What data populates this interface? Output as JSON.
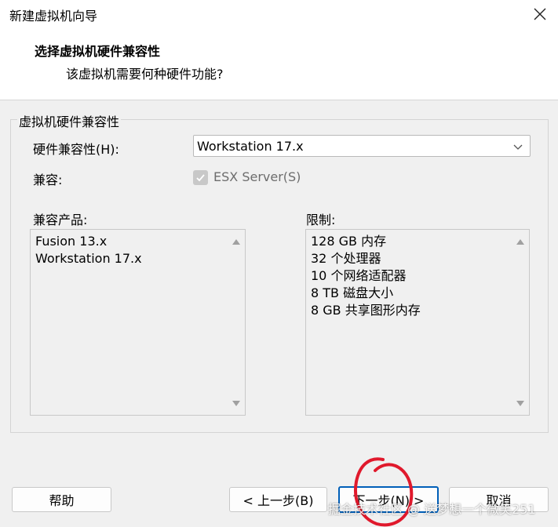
{
  "window": {
    "title": "新建虚拟机向导"
  },
  "header": {
    "title": "选择虚拟机硬件兼容性",
    "subtitle": "该虚拟机需要何种硬件功能?"
  },
  "group": {
    "legend": "虚拟机硬件兼容性",
    "hw_compat_label": "硬件兼容性(H):",
    "hw_compat_value": "Workstation 17.x",
    "compatible_label": "兼容:",
    "esx_label": "ESX Server(S)",
    "esx_checked": true,
    "products_label": "兼容产品:",
    "products": [
      "Fusion 13.x",
      "Workstation 17.x"
    ],
    "limits_label": "限制:",
    "limits": [
      "128 GB 内存",
      "32 个处理器",
      "10 个网络适配器",
      "8 TB 磁盘大小",
      "8 GB 共享图形内存"
    ]
  },
  "footer": {
    "help": "帮助",
    "back": "< 上一步(B)",
    "next": "下一步(N) >",
    "cancel": "取消"
  },
  "watermark": "掘金技术社区 @ 送梦想一个微笑251",
  "colors": {
    "primary_border": "#005fb8",
    "annotation": "#e0192c"
  }
}
